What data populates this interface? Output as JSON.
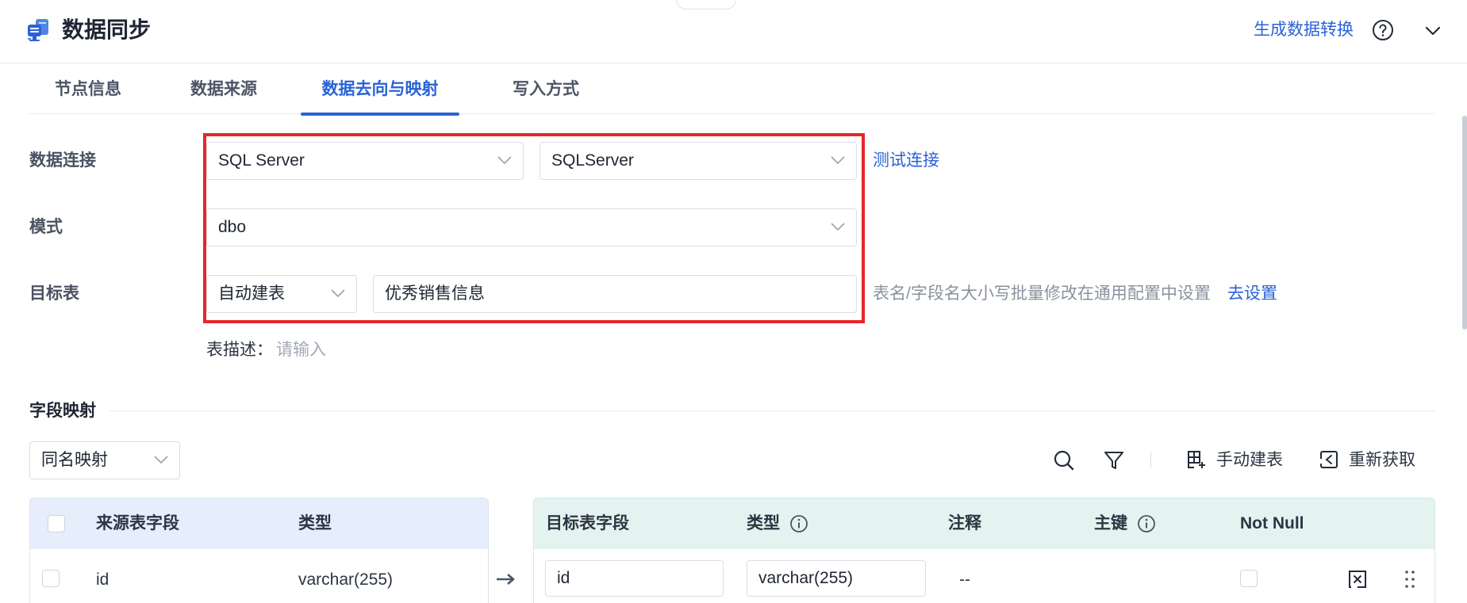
{
  "header": {
    "title": "数据同步",
    "generate_link": "生成数据转换"
  },
  "tabs": [
    {
      "label": "节点信息",
      "active": false
    },
    {
      "label": "数据来源",
      "active": false
    },
    {
      "label": "数据去向与映射",
      "active": true
    },
    {
      "label": "写入方式",
      "active": false
    }
  ],
  "form": {
    "connection": {
      "label": "数据连接",
      "db_type": "SQL Server",
      "connection_name": "SQLServer",
      "test_link": "测试连接"
    },
    "schema": {
      "label": "模式",
      "value": "dbo"
    },
    "target_table": {
      "label": "目标表",
      "mode": "自动建表",
      "table_name": "优秀销售信息",
      "hint": "表名/字段名大小写批量修改在通用配置中设置",
      "settings_link": "去设置"
    },
    "description": {
      "label": "表描述：",
      "placeholder": "请输入",
      "value": ""
    }
  },
  "field_mapping": {
    "title": "字段映射",
    "mapping_mode": "同名映射",
    "toolbar": {
      "manual_create": "手动建表",
      "refresh": "重新获取"
    },
    "source_table": {
      "columns": [
        "来源表字段",
        "类型"
      ],
      "rows": [
        {
          "field": "id",
          "type": "varchar(255)"
        }
      ]
    },
    "target_table": {
      "columns": [
        "目标表字段",
        "类型",
        "注释",
        "主键",
        "Not Null"
      ],
      "rows": [
        {
          "field": "id",
          "type": "varchar(255)",
          "comment": "--",
          "primary_key": false,
          "not_null": false
        }
      ]
    }
  },
  "colors": {
    "accent": "#2a62d6",
    "highlight_border": "#e8262a",
    "source_header_bg": "#e6eefc",
    "target_header_bg": "#e4f3ef"
  }
}
